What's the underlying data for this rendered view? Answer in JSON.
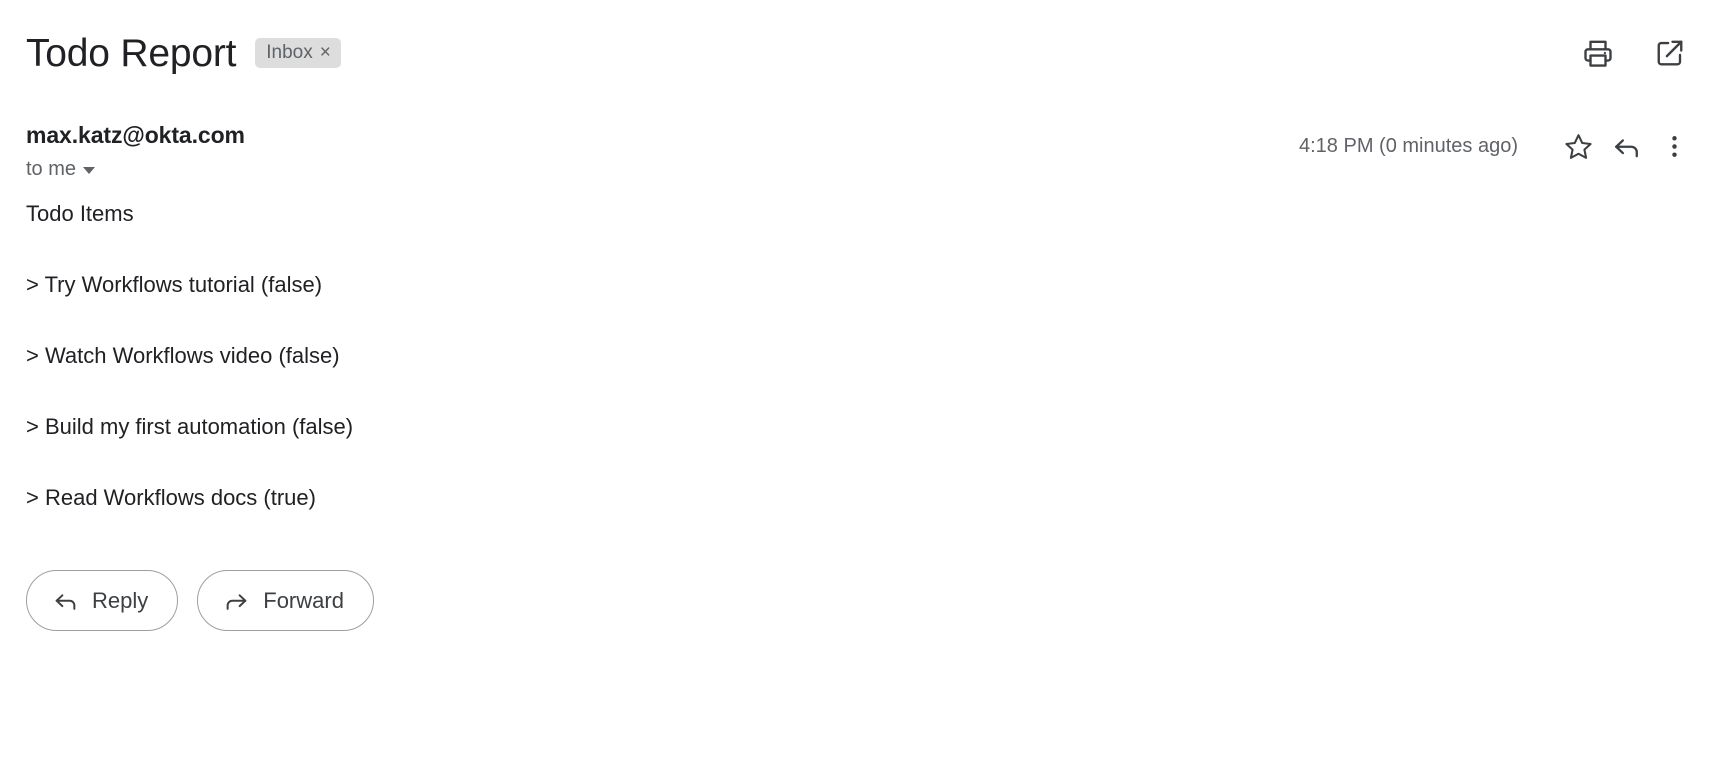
{
  "email": {
    "subject": "Todo Report",
    "label": {
      "name": "Inbox",
      "remove_glyph": "×"
    },
    "sender": "max.katz@okta.com",
    "recipient": "to me",
    "timestamp": "4:18 PM (0 minutes ago)",
    "body_lines": [
      "Todo Items",
      "> Try Workflows tutorial (false)",
      "> Watch Workflows video (false)",
      "> Build my first automation (false)",
      "> Read Workflows docs (true)"
    ],
    "todo_items": [
      {
        "text": "Try Workflows tutorial",
        "done": "false"
      },
      {
        "text": "Watch Workflows video",
        "done": "false"
      },
      {
        "text": "Build my first automation",
        "done": "false"
      },
      {
        "text": "Read Workflows docs",
        "done": "true"
      }
    ]
  },
  "header_actions": [
    {
      "icon": "print-icon",
      "label": "Print all"
    },
    {
      "icon": "open-in-new-icon",
      "label": "Open in new window"
    }
  ],
  "message_actions": [
    {
      "icon": "star-icon",
      "label": "Star"
    },
    {
      "icon": "reply-arrow-icon",
      "label": "Reply"
    },
    {
      "icon": "more-vertical-icon",
      "label": "More"
    }
  ],
  "footer": {
    "reply_label": "Reply",
    "forward_label": "Forward"
  },
  "colors": {
    "text_primary": "#202124",
    "text_secondary": "#5f6368",
    "chip_background": "#ddddde",
    "button_border": "#9c9fa3",
    "page_background": "#ffffff"
  }
}
